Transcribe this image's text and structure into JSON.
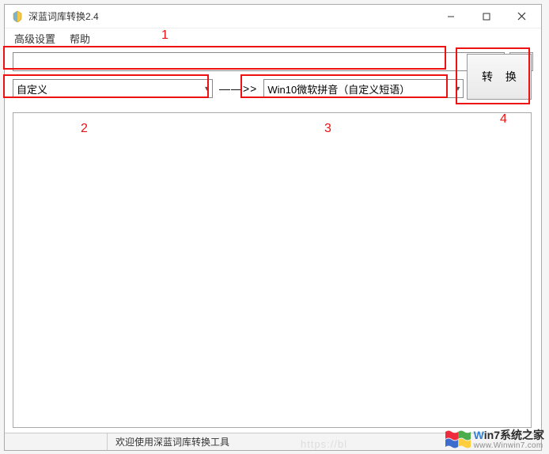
{
  "window": {
    "title": "深蓝词库转换2.4"
  },
  "menu": {
    "advanced": "高级设置",
    "help": "帮助"
  },
  "inputs": {
    "path_value": "",
    "browse_label": "...",
    "source_selected": "自定义",
    "arrow": "——>>",
    "target_selected": "Win10微软拼音（自定义短语）",
    "convert_label": "转 换"
  },
  "annotations": {
    "n1": "1",
    "n2": "2",
    "n3": "3",
    "n4": "4"
  },
  "status": {
    "message": "欢迎使用深蓝词库转换工具"
  },
  "watermark": {
    "brand_prefix": "W",
    "brand_mid": "in",
    "brand_suffix": "7系统之家",
    "url": "www.Winwin7.com"
  },
  "ghost": {
    "url": "https://bl"
  }
}
